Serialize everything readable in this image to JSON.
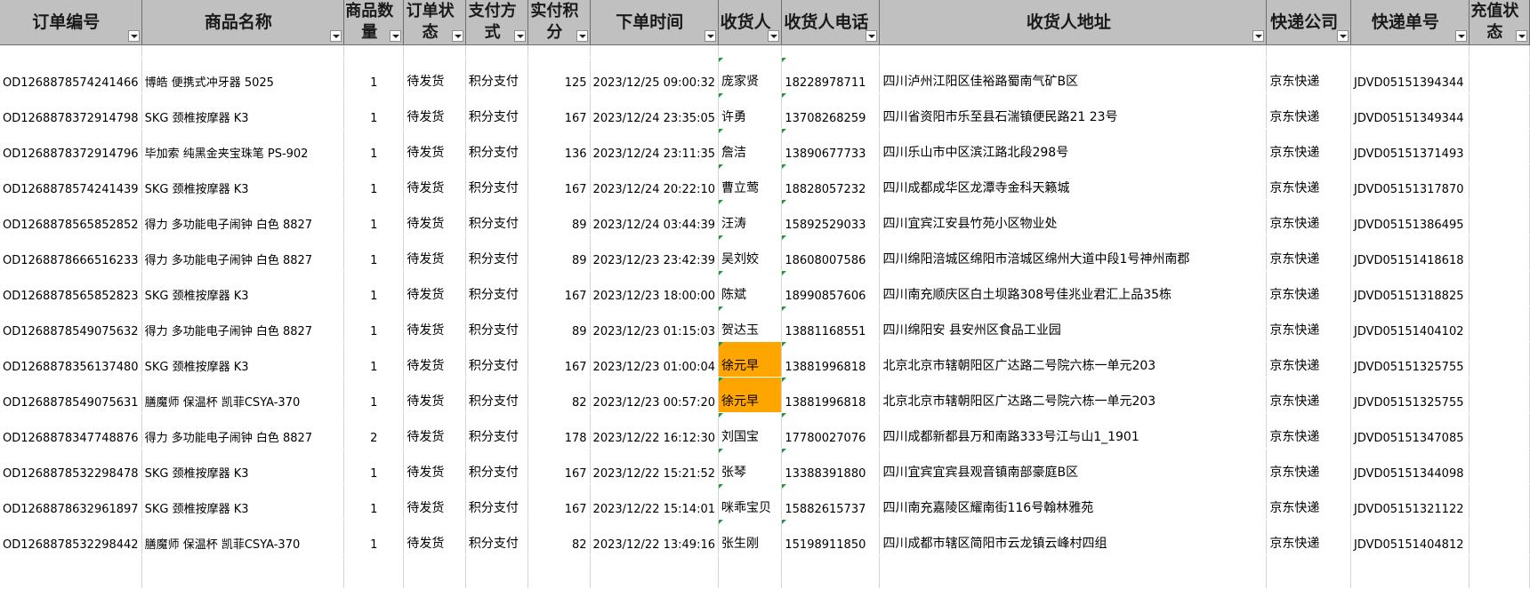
{
  "headers": [
    "订单编号",
    "商品名称",
    "商品数量",
    "订单状态",
    "支付方式",
    "实付积分",
    "下单时间",
    "收货人",
    "收货人电话",
    "收货人地址",
    "快递公司",
    "快递单号",
    "充值状态"
  ],
  "header_lines": [
    [
      "订单编号"
    ],
    [
      "商品名称"
    ],
    [
      "商品数",
      "量"
    ],
    [
      "订单状",
      "态"
    ],
    [
      "支付方",
      "式"
    ],
    [
      "实付积",
      "分"
    ],
    [
      "下单时间"
    ],
    [
      "收货人"
    ],
    [
      "收货人电话"
    ],
    [
      "收货人地址"
    ],
    [
      "快递公司"
    ],
    [
      "快递单号"
    ],
    [
      "充值状",
      "态"
    ]
  ],
  "highlight_color": "#ffa500",
  "rows": [
    {
      "order_id": "OD1268878574241466",
      "product": "博皓 便携式冲牙器 5025",
      "qty": "1",
      "status": "待发货",
      "pay": "积分支付",
      "points": "125",
      "time": "2023/12/25 09:00:32",
      "receiver": "庞家贤",
      "phone": "18228978711",
      "address": "四川泸州江阳区佳裕路蜀南气矿B区",
      "courier": "京东快递",
      "tracking": "JDVD05151394344",
      "recharge": "",
      "highlight": false
    },
    {
      "order_id": "OD1268878372914798",
      "product": "SKG 颈椎按摩器 K3",
      "qty": "1",
      "status": "待发货",
      "pay": "积分支付",
      "points": "167",
      "time": "2023/12/24 23:35:05",
      "receiver": "许勇",
      "phone": "13708268259",
      "address": "四川省资阳市乐至县石湍镇便民路21 23号",
      "courier": "京东快递",
      "tracking": "JDVD05151349344",
      "recharge": "",
      "highlight": false
    },
    {
      "order_id": "OD1268878372914796",
      "product": "毕加索 纯黑金夹宝珠笔 PS-902",
      "qty": "1",
      "status": "待发货",
      "pay": "积分支付",
      "points": "136",
      "time": "2023/12/24 23:11:35",
      "receiver": "詹洁",
      "phone": "13890677733",
      "address": "四川乐山市中区滨江路北段298号",
      "courier": "京东快递",
      "tracking": "JDVD05151371493",
      "recharge": "",
      "highlight": false
    },
    {
      "order_id": "OD1268878574241439",
      "product": "SKG 颈椎按摩器 K3",
      "qty": "1",
      "status": "待发货",
      "pay": "积分支付",
      "points": "167",
      "time": "2023/12/24 20:22:10",
      "receiver": "曹立莺",
      "phone": "18828057232",
      "address": "四川成都成华区龙潭寺金科天籁城",
      "courier": "京东快递",
      "tracking": "JDVD05151317870",
      "recharge": "",
      "highlight": false
    },
    {
      "order_id": "OD1268878565852852",
      "product": "得力 多功能电子闹钟 白色 8827",
      "qty": "1",
      "status": "待发货",
      "pay": "积分支付",
      "points": "89",
      "time": "2023/12/24 03:44:39",
      "receiver": "汪涛",
      "phone": "15892529033",
      "address": "四川宜宾江安县竹苑小区物业处",
      "courier": "京东快递",
      "tracking": "JDVD05151386495",
      "recharge": "",
      "highlight": false
    },
    {
      "order_id": "OD1268878666516233",
      "product": "得力 多功能电子闹钟 白色 8827",
      "qty": "1",
      "status": "待发货",
      "pay": "积分支付",
      "points": "89",
      "time": "2023/12/23 23:42:39",
      "receiver": "吴刘姣",
      "phone": "18608007586",
      "address": "四川绵阳涪城区绵阳市涪城区绵州大道中段1号神州南郡",
      "courier": "京东快递",
      "tracking": "JDVD05151418618",
      "recharge": "",
      "highlight": false
    },
    {
      "order_id": "OD1268878565852823",
      "product": "SKG 颈椎按摩器 K3",
      "qty": "1",
      "status": "待发货",
      "pay": "积分支付",
      "points": "167",
      "time": "2023/12/23 18:00:00",
      "receiver": "陈斌",
      "phone": "18990857606",
      "address": "四川南充顺庆区白土坝路308号佳兆业君汇上品35栋",
      "courier": "京东快递",
      "tracking": "JDVD05151318825",
      "recharge": "",
      "highlight": false
    },
    {
      "order_id": "OD1268878549075632",
      "product": "得力 多功能电子闹钟 白色 8827",
      "qty": "1",
      "status": "待发货",
      "pay": "积分支付",
      "points": "89",
      "time": "2023/12/23 01:15:03",
      "receiver": "贺达玉",
      "phone": "13881168551",
      "address": "四川绵阳安 县安州区食品工业园",
      "courier": "京东快递",
      "tracking": "JDVD05151404102",
      "recharge": "",
      "highlight": false
    },
    {
      "order_id": "OD1268878356137480",
      "product": "SKG 颈椎按摩器 K3",
      "qty": "1",
      "status": "待发货",
      "pay": "积分支付",
      "points": "167",
      "time": "2023/12/23 01:00:04",
      "receiver": "徐元早",
      "phone": "13881996818",
      "address": "北京北京市辖朝阳区广达路二号院六栋一单元203",
      "courier": "京东快递",
      "tracking": "JDVD05151325755",
      "recharge": "",
      "highlight": true
    },
    {
      "order_id": "OD1268878549075631",
      "product": "膳魔师 保温杯 凯菲CSYA-370",
      "qty": "1",
      "status": "待发货",
      "pay": "积分支付",
      "points": "82",
      "time": "2023/12/23 00:57:20",
      "receiver": "徐元早",
      "phone": "13881996818",
      "address": "北京北京市辖朝阳区广达路二号院六栋一单元203",
      "courier": "京东快递",
      "tracking": "JDVD05151325755",
      "recharge": "",
      "highlight": true
    },
    {
      "order_id": "OD1268878347748876",
      "product": "得力 多功能电子闹钟 白色 8827",
      "qty": "2",
      "status": "待发货",
      "pay": "积分支付",
      "points": "178",
      "time": "2023/12/22 16:12:30",
      "receiver": "刘国宝",
      "phone": "17780027076",
      "address": "四川成都新都县万和南路333号江与山1_1901",
      "courier": "京东快递",
      "tracking": "JDVD05151347085",
      "recharge": "",
      "highlight": false
    },
    {
      "order_id": "OD1268878532298478",
      "product": "SKG 颈椎按摩器 K3",
      "qty": "1",
      "status": "待发货",
      "pay": "积分支付",
      "points": "167",
      "time": "2023/12/22 15:21:52",
      "receiver": "张琴",
      "phone": "13388391880",
      "address": "四川宜宾宜宾县观音镇南部豪庭B区",
      "courier": "京东快递",
      "tracking": "JDVD05151344098",
      "recharge": "",
      "highlight": false
    },
    {
      "order_id": "OD1268878632961897",
      "product": "SKG 颈椎按摩器 K3",
      "qty": "1",
      "status": "待发货",
      "pay": "积分支付",
      "points": "167",
      "time": "2023/12/22 15:14:01",
      "receiver": "咪乖宝贝",
      "phone": "15882615737",
      "address": "四川南充嘉陵区耀南街116号翰林雅苑",
      "courier": "京东快递",
      "tracking": "JDVD05151321122",
      "recharge": "",
      "highlight": false
    },
    {
      "order_id": "OD1268878532298442",
      "product": "膳魔师 保温杯 凯菲CSYA-370",
      "qty": "1",
      "status": "待发货",
      "pay": "积分支付",
      "points": "82",
      "time": "2023/12/22 13:49:16",
      "receiver": "张生刚",
      "phone": "15198911850",
      "address": "四川成都市辖区简阳市云龙镇云峰村四组",
      "courier": "京东快递",
      "tracking": "JDVD05151404812",
      "recharge": "",
      "highlight": false
    }
  ]
}
